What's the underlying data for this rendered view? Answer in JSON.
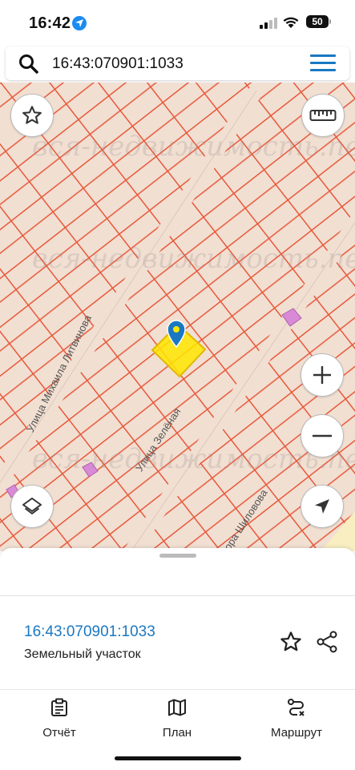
{
  "status": {
    "time": "16:42",
    "battery": "50"
  },
  "search": {
    "value": "16:43:070901:1033"
  },
  "map": {
    "streets": [
      "Улица Михаила Литвинова",
      "Улица Зелёная",
      "ктора Шиловова"
    ],
    "watermark": "вся-недвижимость.net",
    "colors": {
      "grid": "#e8583a",
      "background": "#f1dfd2",
      "selected": "#ffe600",
      "marker": "#1a78c2"
    }
  },
  "sheet": {
    "cadastral_number": "16:43:070901:1033",
    "object_type": "Земельный участок"
  },
  "nav": {
    "report": "Отчёт",
    "plan": "План",
    "route": "Маршрут"
  }
}
